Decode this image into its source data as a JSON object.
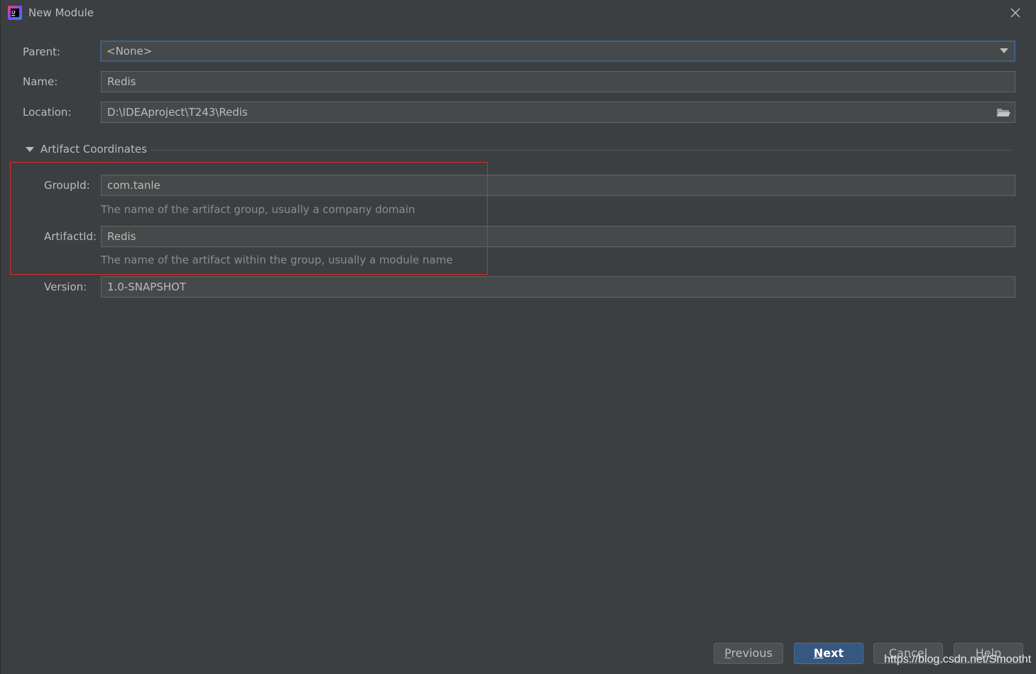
{
  "window": {
    "title": "New Module",
    "icon": "intellij-idea-icon"
  },
  "form": {
    "parent": {
      "label": "Parent:",
      "value": "<None>"
    },
    "name": {
      "label": "Name:",
      "value": "Redis"
    },
    "location": {
      "label": "Location:",
      "value": "D:\\IDEAproject\\T243\\Redis"
    }
  },
  "artifact": {
    "section_title": "Artifact Coordinates",
    "group_id": {
      "label": "GroupId:",
      "value": "com.tanle",
      "hint": "The name of the artifact group, usually a company domain"
    },
    "artifact_id": {
      "label": "ArtifactId:",
      "value": "Redis",
      "hint": "The name of the artifact within the group, usually a module name"
    },
    "version": {
      "label": "Version:",
      "value": "1.0-SNAPSHOT"
    }
  },
  "buttons": {
    "previous": {
      "mnemonic": "P",
      "rest": "revious"
    },
    "next": {
      "mnemonic": "N",
      "rest": "ext"
    },
    "cancel": {
      "mnemonic": "C",
      "rest": "ancel"
    },
    "help": {
      "mnemonic": "H",
      "rest": "elp"
    }
  },
  "watermark": "https://blog.csdn.net/Smootht",
  "colors": {
    "background": "#3c3f41",
    "field_bg": "#45494a",
    "focus_border": "#3d6185",
    "primary_button": "#365880",
    "highlight_box": "#e0262b"
  }
}
